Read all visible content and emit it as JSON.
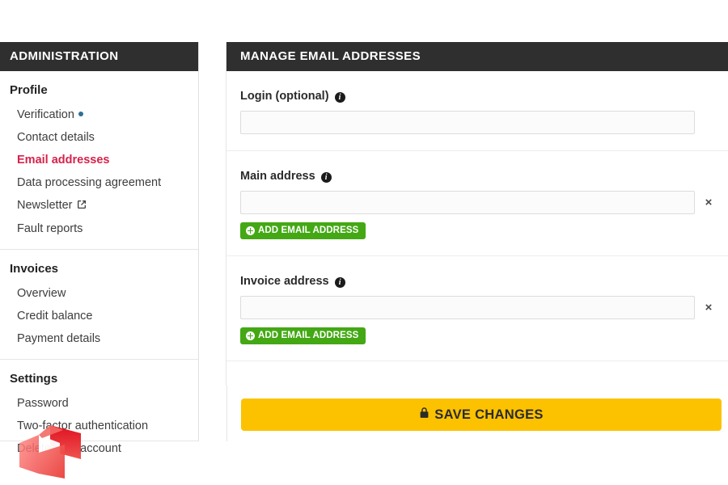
{
  "sidebar": {
    "header": "ADMINISTRATION",
    "groups": [
      {
        "title": "Profile",
        "items": [
          {
            "label": "Verification",
            "badge": "dot",
            "active": false
          },
          {
            "label": "Contact details",
            "active": false
          },
          {
            "label": "Email addresses",
            "active": true
          },
          {
            "label": "Data processing agreement",
            "active": false
          },
          {
            "label": "Newsletter",
            "badge": "external-link",
            "active": false
          },
          {
            "label": "Fault reports",
            "active": false
          }
        ]
      },
      {
        "title": "Invoices",
        "items": [
          {
            "label": "Overview",
            "active": false
          },
          {
            "label": "Credit balance",
            "active": false
          },
          {
            "label": "Payment details",
            "active": false
          }
        ]
      },
      {
        "title": "Settings",
        "items": [
          {
            "label": "Password",
            "active": false
          },
          {
            "label": "Two-factor authentication",
            "active": false
          },
          {
            "label": "Delete user account",
            "active": false
          }
        ]
      }
    ]
  },
  "main": {
    "header": "MANAGE EMAIL ADDRESSES",
    "sections": [
      {
        "label": "Login (optional)",
        "info_icon": "info-icon",
        "input_value": "",
        "has_remove": false,
        "has_add": false
      },
      {
        "label": "Main address",
        "info_icon": "info-icon",
        "input_value": "",
        "has_remove": true,
        "remove_label": "×",
        "has_add": true,
        "add_label": "ADD EMAIL ADDRESS",
        "add_icon": "plus-circle-icon"
      },
      {
        "label": "Invoice address",
        "info_icon": "info-icon",
        "input_value": "",
        "has_remove": true,
        "remove_label": "×",
        "has_add": true,
        "add_label": "ADD EMAIL ADDRESS",
        "add_icon": "plus-circle-icon"
      }
    ]
  },
  "save": {
    "label": "SAVE CHANGES",
    "icon": "lock-icon"
  },
  "colors": {
    "header_bar": "#2f2f2f",
    "active_nav": "#d6224b",
    "add_button": "#43a814",
    "save_button": "#fcc200",
    "verification_dot": "#2f6f97",
    "watermark": "#e53935"
  }
}
